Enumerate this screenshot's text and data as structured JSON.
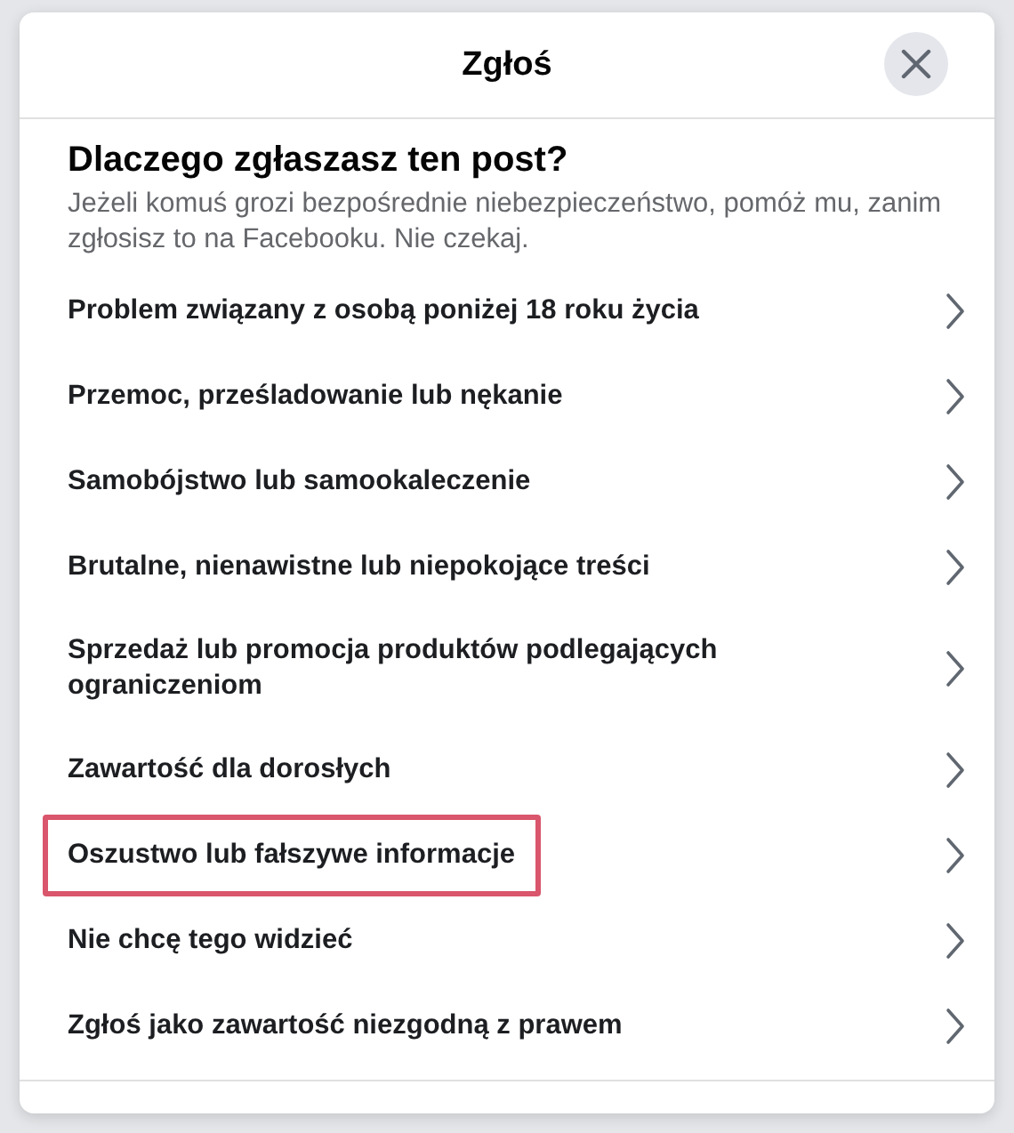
{
  "dialog": {
    "title": "Zgłoś",
    "heading": "Dlaczego zgłaszasz ten post?",
    "description": "Jeżeli komuś grozi bezpośrednie niebezpieczeństwo, pomóż mu, zanim zgłosisz to na Facebooku. Nie czekaj.",
    "items": [
      {
        "label": "Problem związany z osobą poniżej 18 roku życia",
        "highlighted": false
      },
      {
        "label": "Przemoc, prześladowanie lub nękanie",
        "highlighted": false
      },
      {
        "label": "Samobójstwo lub samookaleczenie",
        "highlighted": false
      },
      {
        "label": "Brutalne, nienawistne lub niepokojące treści",
        "highlighted": false
      },
      {
        "label": "Sprzedaż lub promocja produktów podlegających ograniczeniom",
        "highlighted": false
      },
      {
        "label": "Zawartość dla dorosłych",
        "highlighted": false
      },
      {
        "label": "Oszustwo lub fałszywe informacje",
        "highlighted": true
      },
      {
        "label": "Nie chcę tego widzieć",
        "highlighted": false
      },
      {
        "label": "Zgłoś jako zawartość niezgodną z prawem",
        "highlighted": false
      }
    ]
  }
}
